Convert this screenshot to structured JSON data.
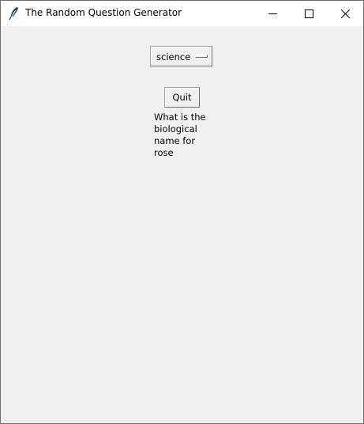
{
  "window": {
    "title": "The Random Question Generator",
    "app_icon": "feather-icon",
    "controls": [
      "minimize-icon",
      "maximize-icon",
      "close-icon"
    ]
  },
  "option_menu": {
    "selected": "science"
  },
  "quit_button": {
    "label": "Quit"
  },
  "question": {
    "text": "What is the biological name for rose"
  }
}
